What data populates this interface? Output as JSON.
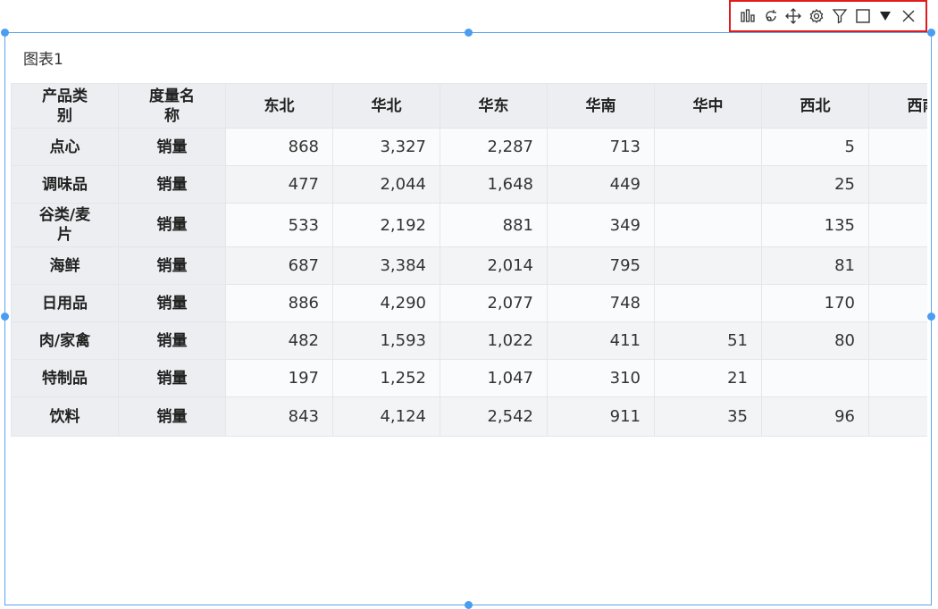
{
  "toolbar": {
    "icons": [
      "chart-type-icon",
      "refresh-icon",
      "move-icon",
      "settings-icon",
      "filter-icon",
      "maximize-icon",
      "dropdown-icon",
      "close-icon"
    ]
  },
  "chart": {
    "title": "图表1"
  },
  "colors": {
    "accent": "#4a9df0",
    "highlight_border": "#e01b1b",
    "header_bg": "#eceef1"
  },
  "table": {
    "headers": [
      "产品类别",
      "度量名称",
      "东北",
      "华北",
      "华东",
      "华南",
      "华中",
      "西北",
      "西南"
    ],
    "rows": [
      {
        "category": "点心",
        "measure": "销量",
        "values": [
          "868",
          "3,327",
          "2,287",
          "713",
          "",
          "5",
          ""
        ]
      },
      {
        "category": "调味品",
        "measure": "销量",
        "values": [
          "477",
          "2,044",
          "1,648",
          "449",
          "",
          "25",
          ""
        ]
      },
      {
        "category": "谷类/麦片",
        "measure": "销量",
        "values": [
          "533",
          "2,192",
          "881",
          "349",
          "",
          "135",
          ""
        ]
      },
      {
        "category": "海鲜",
        "measure": "销量",
        "values": [
          "687",
          "3,384",
          "2,014",
          "795",
          "",
          "81",
          ""
        ]
      },
      {
        "category": "日用品",
        "measure": "销量",
        "values": [
          "886",
          "4,290",
          "2,077",
          "748",
          "",
          "170",
          ""
        ]
      },
      {
        "category": "肉/家禽",
        "measure": "销量",
        "values": [
          "482",
          "1,593",
          "1,022",
          "411",
          "51",
          "80",
          ""
        ]
      },
      {
        "category": "特制品",
        "measure": "销量",
        "values": [
          "197",
          "1,252",
          "1,047",
          "310",
          "21",
          "",
          ""
        ]
      },
      {
        "category": "饮料",
        "measure": "销量",
        "values": [
          "843",
          "4,124",
          "2,542",
          "911",
          "35",
          "96",
          ""
        ]
      }
    ]
  }
}
